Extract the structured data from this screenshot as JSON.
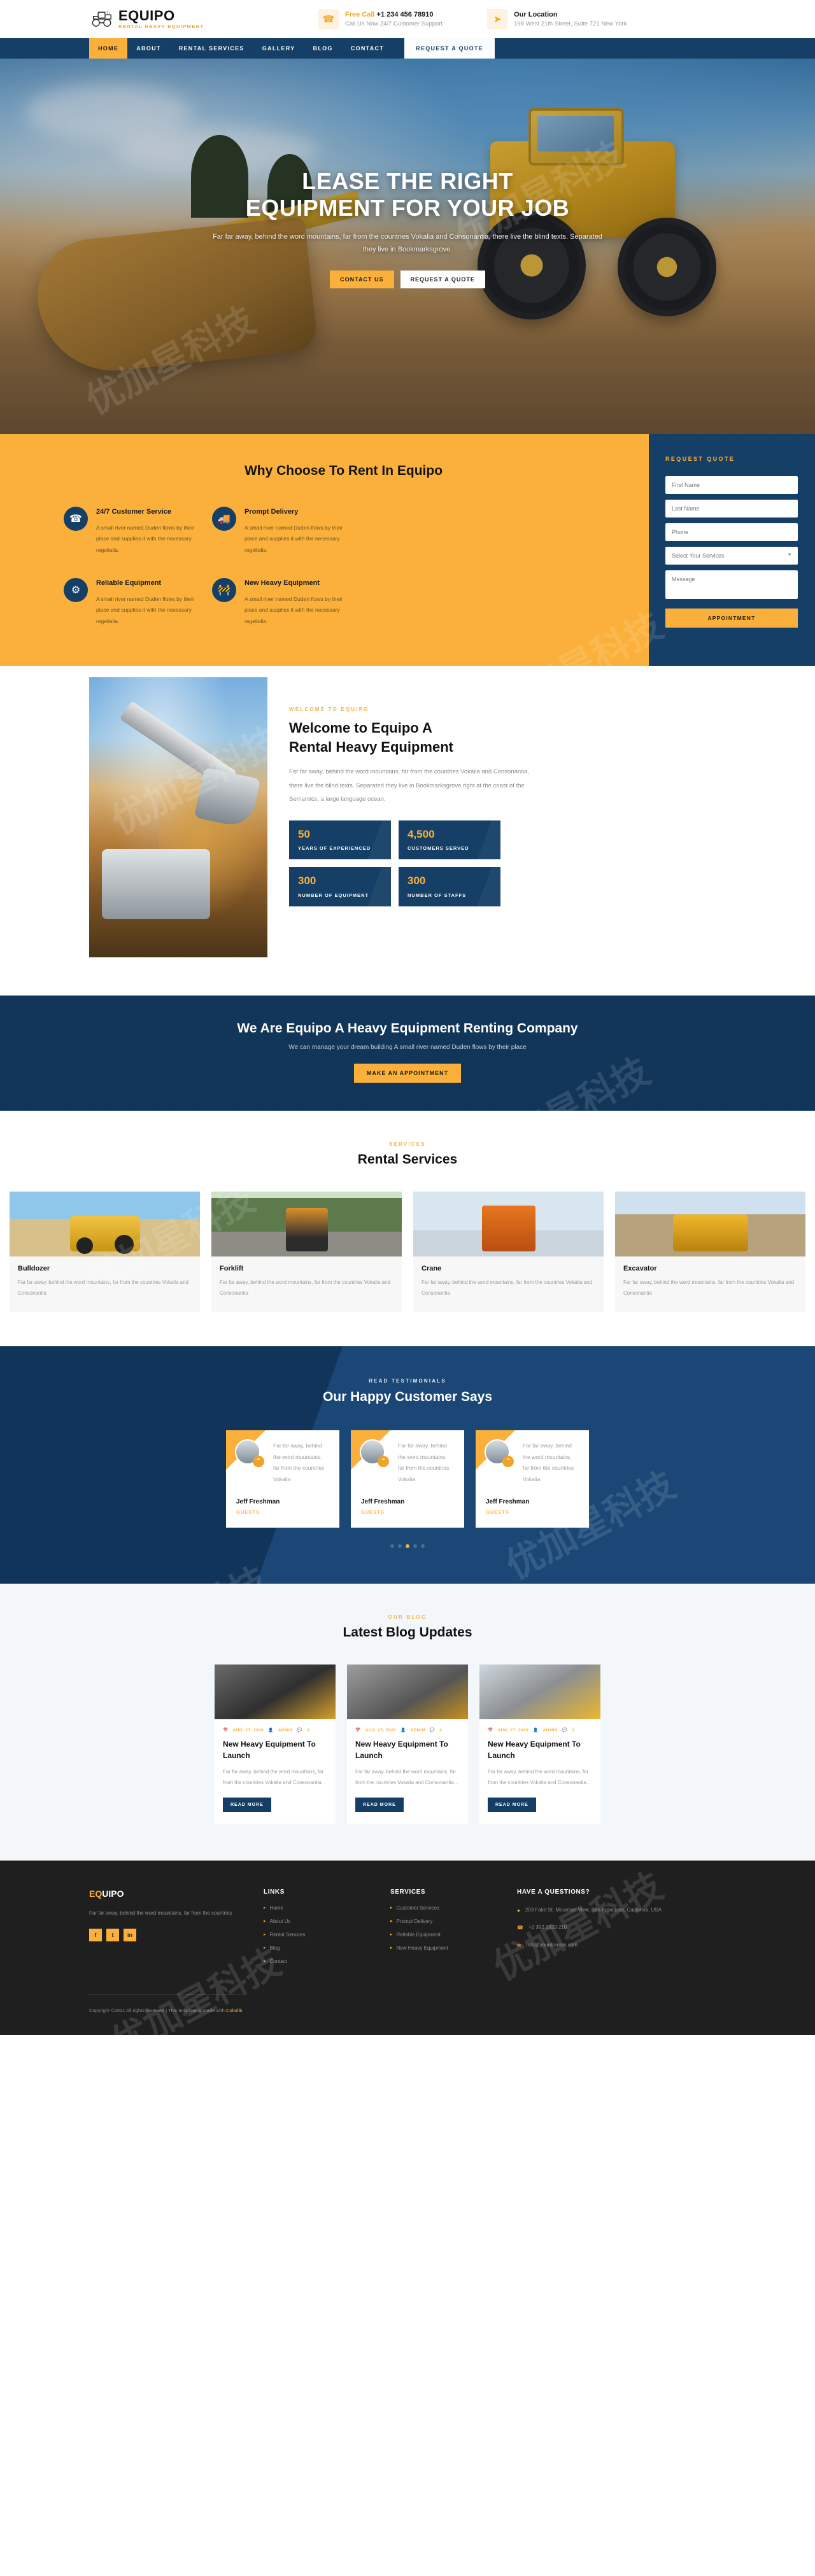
{
  "brand": {
    "name": "EQUIPO",
    "tagline": "RENTAL HEAVY EQUIPMENT",
    "logo_icon": "bulldozer-icon"
  },
  "topbar": {
    "phone": {
      "icon": "phone-icon",
      "label": "Free Call",
      "value": "+1 234 456 78910",
      "sub": "Call Us Now 24/7 Customer Support"
    },
    "location": {
      "icon": "paper-plane-icon",
      "label": "Our Location",
      "sub": "198 West 21th Street, Suite 721 New York"
    }
  },
  "nav": {
    "items": [
      {
        "label": "HOME",
        "active": true
      },
      {
        "label": "ABOUT",
        "active": false
      },
      {
        "label": "RENTAL SERVICES",
        "active": false
      },
      {
        "label": "GALLERY",
        "active": false
      },
      {
        "label": "BLOG",
        "active": false
      },
      {
        "label": "CONTACT",
        "active": false
      }
    ],
    "cta": "REQUEST A QUOTE"
  },
  "hero": {
    "title_line1": "LEASE THE RIGHT",
    "title_line2": "EQUIPMENT FOR YOUR JOB",
    "paragraph": "Far far away, behind the word mountains, far from the countries Vokalia and Consonantia, there live the blind texts. Separated they live in Bookmarksgrove.",
    "btn_primary": "CONTACT US",
    "btn_secondary": "REQUEST A QUOTE"
  },
  "why": {
    "heading": "Why Choose To Rent In Equipo",
    "items": [
      {
        "icon": "headset-support-icon",
        "title": "24/7 Customer Service",
        "text": "A small river named Duden flows by their place and supplies it with the necessary regelialia."
      },
      {
        "icon": "delivery-truck-icon",
        "title": "Prompt Delivery",
        "text": "A small river named Duden flows by their place and supplies it with the necessary regelialia."
      },
      {
        "icon": "reliable-gear-icon",
        "title": "Reliable Equipment",
        "text": "A small river named Duden flows by their place and supplies it with the necessary regelialia."
      },
      {
        "icon": "new-equipment-icon",
        "title": "New Heavy Equipment",
        "text": "A small river named Duden flows by their place and supplies it with the necessary regelialia."
      }
    ]
  },
  "quote_form": {
    "title": "REQUEST QUOTE",
    "first_name_placeholder": "First Name",
    "last_name_placeholder": "Last Name",
    "phone_placeholder": "Phone",
    "service_placeholder": "Select Your Services",
    "message_placeholder": "Message",
    "submit_label": "APPOINTMENT"
  },
  "welcome": {
    "eyebrow": "WELCOME TO EQUIPO",
    "heading_line1": "Welcome to Equipo A",
    "heading_line2": "Rental Heavy Equipment",
    "paragraph": "Far far away, behind the word mountains, far from the countries Vokalia and Consonantia, there live the blind texts. Separated they live in Bookmarksgrove right at the coast of the Semantics, a large language ocean.",
    "image_alt": "excavator-working-image",
    "stats": [
      {
        "number": "50",
        "label": "YEARS OF EXPERIENCED"
      },
      {
        "number": "4,500",
        "label": "CUSTOMERS SERVED"
      },
      {
        "number": "300",
        "label": "NUMBER OF EQUIPMENT"
      },
      {
        "number": "300",
        "label": "NUMBER OF STAFFS"
      }
    ]
  },
  "cta": {
    "heading": "We Are Equipo A Heavy Equipment Renting Company",
    "sub": "We can manage your dream building A small river named Duden flows by their place",
    "button": "MAKE AN APPOINTMENT"
  },
  "services": {
    "eyebrow": "SERVICES",
    "heading": "Rental Services",
    "cards": [
      {
        "image": "bulldozer-photo",
        "title": "Bulldozer",
        "desc": "Far far away, behind the word mountains, far from the countries Vokalia and Consonantia"
      },
      {
        "image": "forklift-photo",
        "title": "Forklift",
        "desc": "Far far away, behind the word mountains, far from the countries Vokalia and Consonantia"
      },
      {
        "image": "crane-photo",
        "title": "Crane",
        "desc": "Far far away, behind the word mountains, far from the countries Vokalia and Consonantia"
      },
      {
        "image": "excavator-photo",
        "title": "Excavator",
        "desc": "Far far away, behind the word mountains, far from the countries Vokalia and Consonantia"
      }
    ]
  },
  "testimonials": {
    "eyebrow": "READ TESTIMONIALS",
    "heading": "Our Happy Customer Says",
    "cards": [
      {
        "avatar": "customer-avatar-1",
        "text": "Far far away, behind the word mountains, far from the countries Vokalia",
        "name": "Jeff Freshman",
        "role": "GUESTS"
      },
      {
        "avatar": "customer-avatar-2",
        "text": "Far far away, behind the word mountains, far from the countries Vokalia",
        "name": "Jeff Freshman",
        "role": "GUESTS"
      },
      {
        "avatar": "customer-avatar-3",
        "text": "Far far away, behind the word mountains, far from the countries Vokalia",
        "name": "Jeff Freshman",
        "role": "GUESTS"
      }
    ],
    "dots": 5,
    "active_dot": 2
  },
  "blog": {
    "eyebrow": "OUR BLOG",
    "heading": "Latest Blog Updates",
    "posts": [
      {
        "image": "excavator-coal-photo",
        "date": "AUG. 27, 2020",
        "author": "ADMIN",
        "comments": "3",
        "title": "New Heavy Equipment To Launch",
        "desc": "Far far away, behind the word mountains, far from the countries Vokalia and Consonantia...",
        "button": "READ MORE"
      },
      {
        "image": "loader-gravel-photo",
        "date": "AUG. 27, 2020",
        "author": "ADMIN",
        "comments": "3",
        "title": "New Heavy Equipment To Launch",
        "desc": "Far far away, behind the word mountains, far from the countries Vokalia and Consonantia...",
        "button": "READ MORE"
      },
      {
        "image": "bulldozer-snow-photo",
        "date": "AUG. 27, 2020",
        "author": "ADMIN",
        "comments": "3",
        "title": "New Heavy Equipment To Launch",
        "desc": "Far far away, behind the word mountains, far from the countries Vokalia and Consonantia...",
        "button": "READ MORE"
      }
    ]
  },
  "footer": {
    "brand_accent": "EQ",
    "brand_rest": "UIPO",
    "about": "Far far away, behind the word mountains, far from the countries",
    "socials": [
      "f",
      "t",
      "in"
    ],
    "links_heading": "LINKS",
    "links": [
      "Home",
      "About Us",
      "Rental Services",
      "Blog",
      "Contact"
    ],
    "services_heading": "SERVICES",
    "services": [
      "Customer Services",
      "Prompt Delivery",
      "Reliable Equipment",
      "New Heavy Equipment"
    ],
    "contact_heading": "HAVE A QUESTIONS?",
    "address": "203 Fake St. Mountain View, San Francisco, California, USA",
    "phone": "+2 392 3929 210",
    "email": "info@yourdomain.com",
    "copyright": "Copyright ©2021 All rights reserved | This template is made with",
    "copyright_link": "Colorlib"
  },
  "colors": {
    "navy": "#153f66",
    "amber": "#fbb03b",
    "dark": "#1f1f1f"
  }
}
